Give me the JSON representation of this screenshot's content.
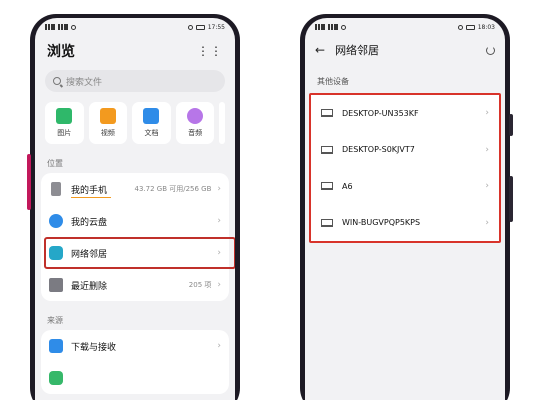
{
  "left_phone": {
    "status": {
      "left": "",
      "right": "17:55"
    },
    "title": "浏览",
    "more_icon": "more-dots-icon",
    "search": {
      "placeholder": "搜索文件"
    },
    "categories": [
      {
        "label": "图片",
        "icon": "image-icon",
        "color": "#2fb86a"
      },
      {
        "label": "视频",
        "icon": "video-icon",
        "color": "#f39a1f"
      },
      {
        "label": "文档",
        "icon": "document-icon",
        "color": "#2f8ce8"
      },
      {
        "label": "音频",
        "icon": "audio-icon",
        "color": "#b776e8"
      }
    ],
    "location_header": "位置",
    "locations": [
      {
        "label": "我的手机",
        "value": "43.72 GB 可用/256 GB",
        "icon": "phone-icon"
      },
      {
        "label": "我的云盘",
        "value": "",
        "icon": "cloud-icon"
      },
      {
        "label": "网络邻居",
        "value": "",
        "icon": "network-icon"
      },
      {
        "label": "最近删除",
        "value": "205 项",
        "icon": "trash-icon"
      }
    ],
    "source_header": "来源",
    "sources": [
      {
        "label": "下载与接收",
        "icon": "download-icon"
      }
    ]
  },
  "right_phone": {
    "status": {
      "left": "",
      "right": "18:03"
    },
    "title": "网络邻居",
    "back_icon": "back-arrow-icon",
    "refresh_icon": "refresh-icon",
    "section": "其他设备",
    "devices": [
      {
        "label": "DESKTOP-UN353KF"
      },
      {
        "label": "DESKTOP-S0KJVT7"
      },
      {
        "label": "A6"
      },
      {
        "label": "WIN-BUGVPQP5KPS"
      }
    ]
  },
  "colors": {
    "highlight": "#c0302a",
    "accent": "#f39a1f"
  }
}
